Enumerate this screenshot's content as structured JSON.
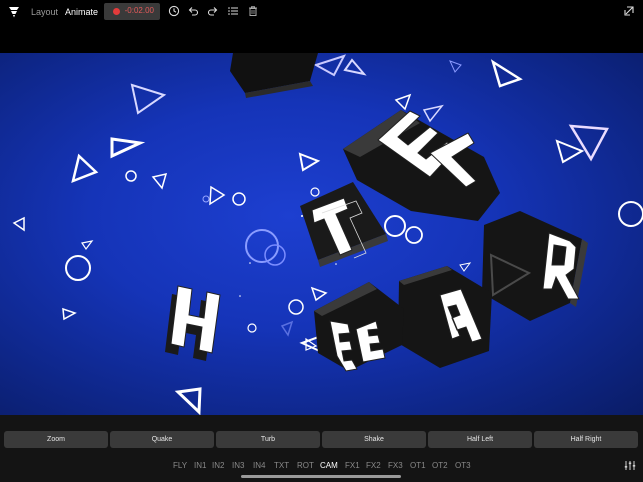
{
  "toolbar": {
    "logo_icon": "app-logo-icon",
    "tabs": [
      {
        "label": "Layout",
        "active": false
      },
      {
        "label": "Animate",
        "active": true
      }
    ],
    "record": {
      "time": "-0:02.00",
      "dot_color": "#e33b3b"
    },
    "icons": [
      "clock-icon",
      "undo-icon",
      "redo-icon",
      "list-icon",
      "trash-icon",
      "export-icon"
    ]
  },
  "canvas": {
    "background": "#1534b8",
    "letters": [
      "H",
      "T",
      "E",
      "E",
      "E",
      "A",
      "T",
      "E",
      "R"
    ]
  },
  "presets": [
    "Zoom",
    "Quake",
    "Turb",
    "Shake",
    "Half Left",
    "Half Right"
  ],
  "tracks": {
    "items": [
      "FLY",
      "IN1",
      "IN2",
      "IN3",
      "IN4",
      "TXT",
      "ROT",
      "CAM",
      "FX1",
      "FX2",
      "FX3",
      "OT1",
      "OT2",
      "OT3"
    ],
    "active": "CAM"
  }
}
